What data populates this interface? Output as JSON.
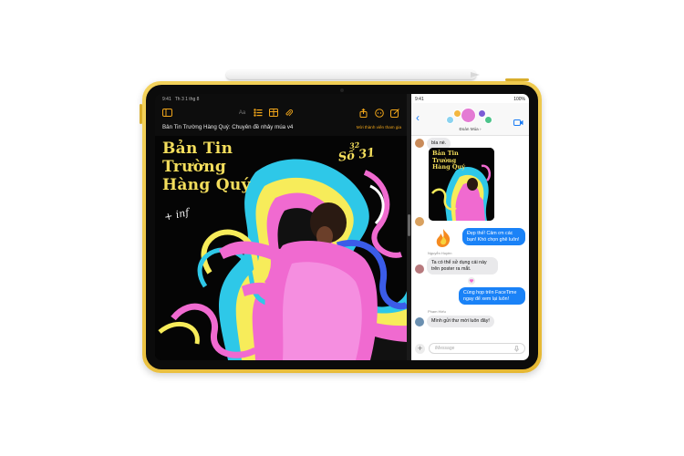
{
  "left_pane": {
    "status_time": "9:41",
    "status_date": "Th 3 1 thg 8",
    "document_title": "Bản Tin Trường Hàng Quý: Chuyên đề nhảy múa v4",
    "share_link": "Mời thành viên tham gia",
    "toolbar_text_label": "Aa",
    "headline": [
      "Bản Tin",
      "Trường",
      "Hàng Quý"
    ],
    "issue_label": "Số 31",
    "issue_small": "32",
    "script_note": "+ inf"
  },
  "messages": {
    "status_time": "9:41",
    "status_battery": "100%",
    "group_name": "Đoàn Múa ›",
    "msg_1": "bìa nè.",
    "msg_2": "Đẹp thế! Cảm ơn các bạn! Khó chọn ghê luôn!",
    "sender_3": "Nguyễn Huyền",
    "msg_3": "Ta có thể sử dụng cái này trên poster ra mắt.",
    "msg_4": "Cùng họp trên FaceTime ngay để xem lại luôn!",
    "sender_5": "Phạm Hiếu",
    "msg_5": "Mình gửi thư mời luôn đây!",
    "input_placeholder": "iMessage",
    "thumb_title": [
      "Bản Tin",
      "Trường",
      "Hàng Quý"
    ]
  },
  "colors": {
    "device_frame": "#f0c744",
    "accent_orange": "#f0a51a",
    "imessage_blue": "#1a82f7",
    "headline_yellow": "#f4de5c",
    "pink": "#f06ad0",
    "cyan": "#2ec8e8"
  },
  "icons": [
    "sidebar-icon",
    "format-icon",
    "table-icon",
    "attachment-icon",
    "share-icon",
    "collaborate-icon",
    "compose-icon",
    "back-icon",
    "video-icon",
    "plus-icon",
    "mic-icon"
  ]
}
